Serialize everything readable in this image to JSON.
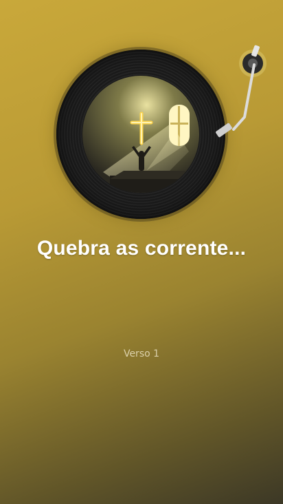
{
  "player": {
    "song_title": "Quebra as corrente...",
    "section_label": "Verso 1"
  },
  "artwork": {
    "icon": "cross-worship-icon"
  },
  "colors": {
    "background_top": "#c9a83a",
    "background_bottom": "#3c3826",
    "title": "#ffffff",
    "neon_cross": "#ffd54a"
  }
}
